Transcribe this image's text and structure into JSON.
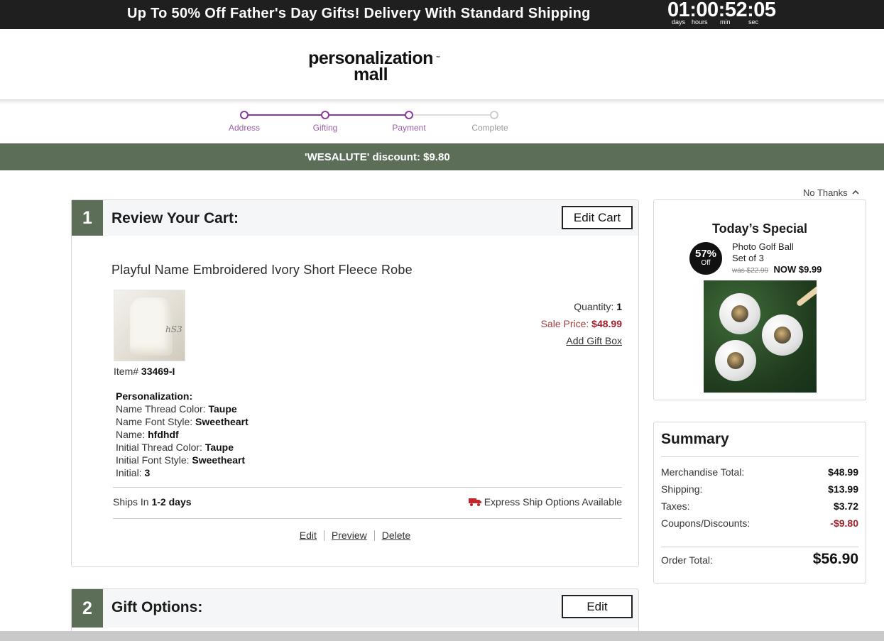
{
  "promo": {
    "text": "Up To 50% Off Father's Day Gifts! Delivery With Standard Shipping",
    "countdown": "01:00:52:05",
    "units": [
      "days",
      "hours",
      "min",
      "sec"
    ]
  },
  "header": {
    "logo_line1": "personalization",
    "logo_line2": "mall",
    "logo_tm": "™"
  },
  "steps": [
    {
      "label": "Address",
      "state": "done"
    },
    {
      "label": "Gifting",
      "state": "done"
    },
    {
      "label": "Payment",
      "state": "current"
    },
    {
      "label": "Complete",
      "state": "pending"
    }
  ],
  "discount_banner": "'WESALUTE' discount: $9.80",
  "no_thanks": "No Thanks",
  "cart": {
    "step_number": "1",
    "title": "Review Your Cart:",
    "edit_cart_label": "Edit Cart",
    "product_name": "Playful Name Embroidered Ivory Short Fleece Robe",
    "thumb_monogram": "hS3",
    "item_label": "Item#",
    "item_number": "33469-I",
    "quantity_label": "Quantity:",
    "quantity": "1",
    "sale_label": "Sale Price:",
    "sale_price": "$48.99",
    "add_gift_box": "Add Gift Box",
    "personalization_heading": "Personalization:",
    "personalization": [
      {
        "label": "Name Thread Color:",
        "value": "Taupe"
      },
      {
        "label": "Name Font Style:",
        "value": "Sweetheart"
      },
      {
        "label": "Name:",
        "value": "hfdhdf"
      },
      {
        "label": "Initial Thread Color:",
        "value": "Taupe"
      },
      {
        "label": "Initial Font Style:",
        "value": "Sweetheart"
      },
      {
        "label": "Initial:",
        "value": "3"
      }
    ],
    "ships_label": "Ships In",
    "ships_value": "1-2 days",
    "express_text": "Express Ship Options Available",
    "actions": [
      "Edit",
      "Preview",
      "Delete"
    ]
  },
  "gift_options": {
    "step_number": "2",
    "title": "Gift Options:",
    "edit_label": "Edit"
  },
  "special": {
    "title": "Today’s Special",
    "badge_pct": "57%",
    "badge_off": "Off",
    "name_line1": "Photo Golf Ball",
    "name_line2": "Set of 3",
    "was_price": "was $22.99",
    "now_price": "NOW $9.99"
  },
  "summary": {
    "title": "Summary",
    "rows": [
      {
        "label": "Merchandise Total:",
        "value": "$48.99"
      },
      {
        "label": "Shipping:",
        "value": "$13.99"
      },
      {
        "label": "Taxes:",
        "value": "$3.72"
      },
      {
        "label": "Coupons/Discounts:",
        "value": "-$9.80"
      }
    ],
    "total_label": "Order Total:",
    "total_value": "$56.90"
  },
  "colors": {
    "brand_green": "#5c6e58",
    "progress_purple": "#8a3a9b",
    "price_red": "#a0202a"
  }
}
